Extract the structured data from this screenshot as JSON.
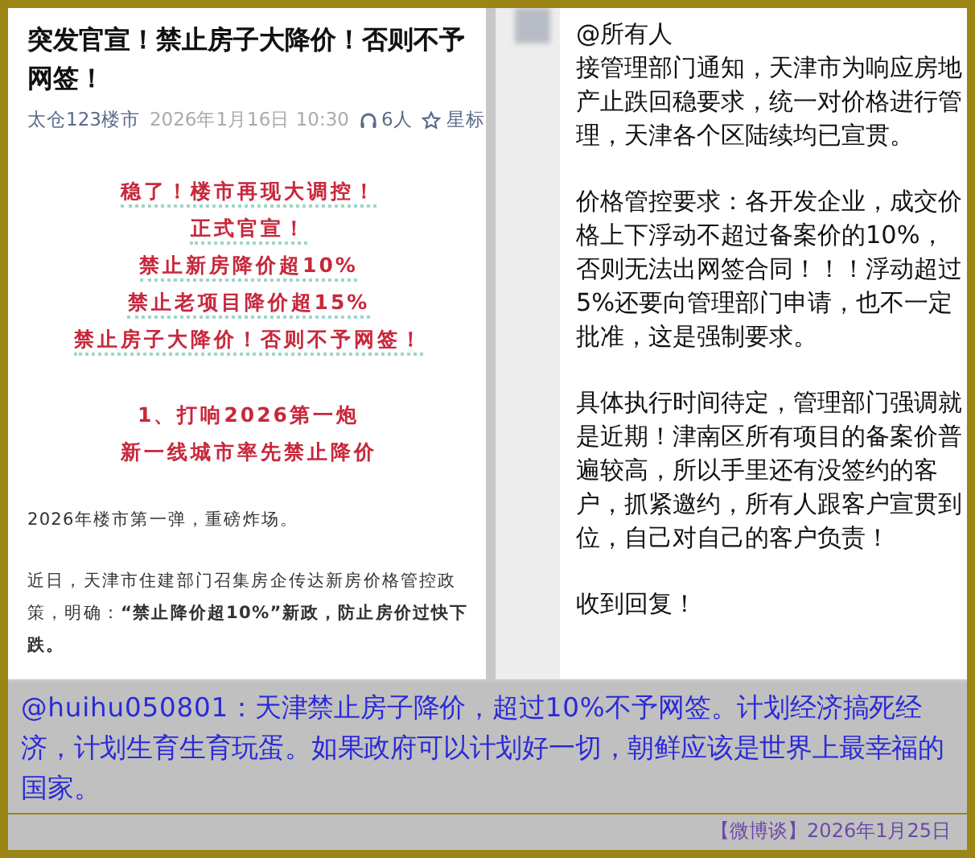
{
  "article": {
    "title": "突发官宣！禁止房子大降价！否则不予网签！",
    "author": "太仓123楼市",
    "date": "2026年1月16日 10:30",
    "listeners": "6人",
    "star_label": "星标",
    "highlight_lines": [
      "稳了！楼市再现大调控！",
      "正式官宣！",
      "禁止新房降价超10%",
      "禁止老项目降价超15%",
      "禁止房子大降价！否则不予网签！"
    ],
    "section_heading_lines": [
      "1、打响2026第一炮",
      "新一线城市率先禁止降价"
    ],
    "paragraphs": [
      "2026年楼市第一弹，重磅炸场。",
      "近日，天津市住建部门召集房企传达新房价格管控政策，明确：**“禁止降价超10%”新政，防止房价过快下跌。**"
    ]
  },
  "message": {
    "mention": "@所有人",
    "paragraphs": [
      "接管理部门通知，天津市为响应房地产止跌回稳要求，统一对价格进行管理，天津各个区陆续均已宣贯。",
      "价格管控要求：各开发企业，成交价格上下浮动不超过备案价的10%，否则无法出网签合同！！！浮动超过 5%还要向管理部门申请，也不一定批准，这是强制要求。",
      "具体执行时间待定，管理部门强调就是近期！津南区所有项目的备案价普遍较高，所以手里还有没签约的客户，抓紧邀约，所有人跟客户宣贯到位，自己对自己的客户负责！",
      "收到回复！"
    ]
  },
  "caption": {
    "text": "@huihu050801：天津禁止房子降价，超过10%不予网签。计划经济搞死经济，计划生育生育玩蛋。如果政府可以计划好一切，朝鲜应该是世界上最幸福的国家。"
  },
  "footer": {
    "source": "【微博谈】2026年1月25日"
  }
}
